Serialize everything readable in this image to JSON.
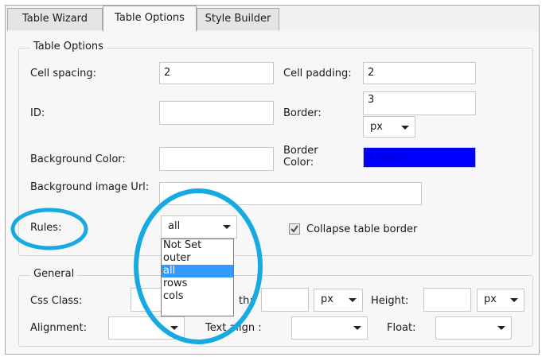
{
  "tabs": [
    "Table Wizard",
    "Table Options",
    "Style Builder"
  ],
  "table_options": {
    "legend": "Table Options",
    "cell_spacing_label": "Cell spacing:",
    "cell_spacing_value": "2",
    "cell_padding_label": "Cell padding:",
    "cell_padding_value": "2",
    "id_label": "ID:",
    "id_value": "",
    "border_label": "Border:",
    "border_value": "3",
    "border_unit": "px",
    "bg_color_label": "Background Color:",
    "bg_color_value": "",
    "border_color_label": "Border Color:",
    "border_color_value": "#0000FF",
    "bg_image_label": "Background image Url:",
    "bg_image_value": "",
    "rules_label": "Rules:",
    "rules_value": "all",
    "rules_options": [
      "Not Set",
      "outer",
      "all",
      "rows",
      "cols"
    ],
    "rules_selected": "all",
    "collapse_label": "Collapse table border",
    "collapse_checked": true
  },
  "general": {
    "legend": "General",
    "css_class_label": "Css Class:",
    "css_class_value": "",
    "width_label": "th:",
    "width_value": "",
    "width_unit": "px",
    "height_label": "Height:",
    "height_value": "",
    "height_unit": "px",
    "alignment_label": "Alignment:",
    "alignment_value": "",
    "text_align_label": "Text align :",
    "text_align_value": "",
    "float_label": "Float:",
    "float_value": ""
  },
  "colors": {
    "highlight_circle": "#17a9e1",
    "selection": "#3399ff",
    "border_color_swatch": "#0000ff",
    "border_color_text": "#0000cc"
  }
}
